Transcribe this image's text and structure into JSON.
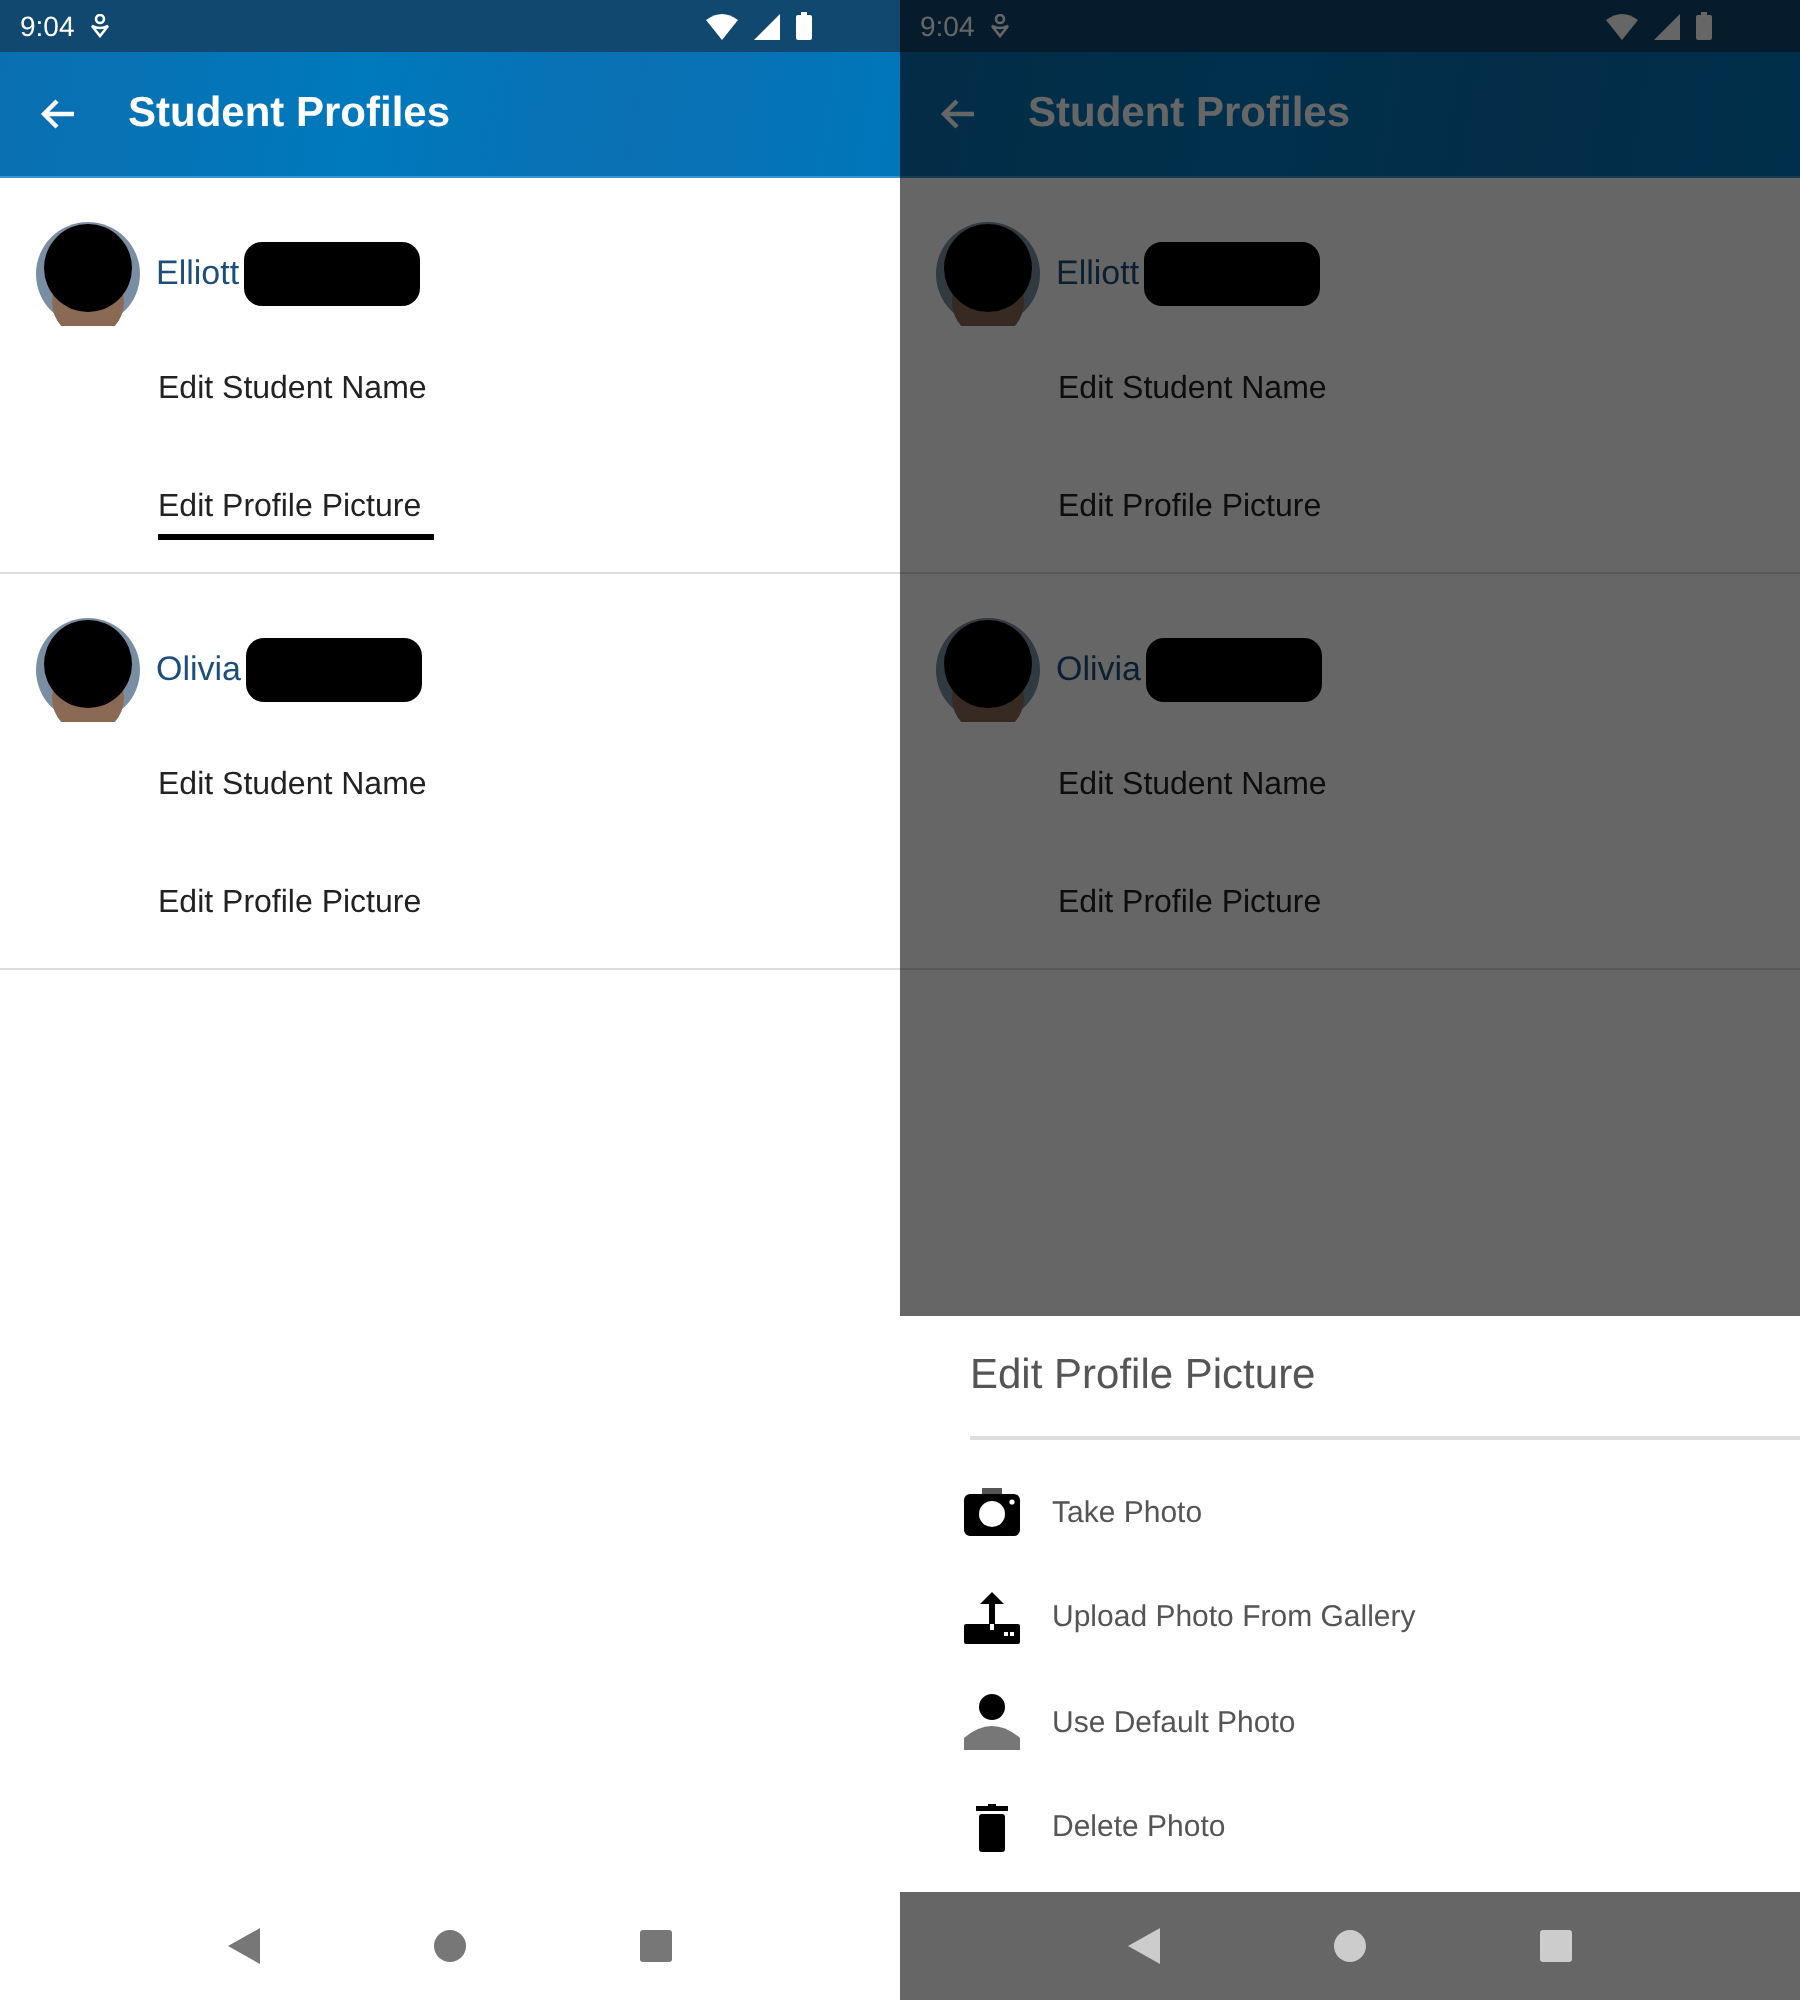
{
  "screens": [
    {
      "status_bar": {
        "time": "9:04"
      },
      "app_bar": {
        "title": "Student Profiles"
      },
      "dimmed": false,
      "students": [
        {
          "name": "Elliott",
          "actions": [
            {
              "label": "Edit Student Name",
              "underlined": false
            },
            {
              "label": "Edit Profile Picture",
              "underlined": true
            }
          ]
        },
        {
          "name": "Olivia",
          "actions": [
            {
              "label": "Edit Student Name",
              "underlined": false
            },
            {
              "label": "Edit Profile Picture",
              "underlined": false
            }
          ]
        }
      ]
    },
    {
      "status_bar": {
        "time": "9:04"
      },
      "app_bar": {
        "title": "Student Profiles"
      },
      "dimmed": true,
      "students": [
        {
          "name": "Elliott",
          "actions": [
            {
              "label": "Edit Student Name",
              "underlined": false
            },
            {
              "label": "Edit Profile Picture",
              "underlined": false
            }
          ]
        },
        {
          "name": "Olivia",
          "actions": [
            {
              "label": "Edit Student Name",
              "underlined": false
            },
            {
              "label": "Edit Profile Picture",
              "underlined": false
            }
          ]
        }
      ],
      "sheet": {
        "title": "Edit Profile Picture",
        "options": [
          {
            "kind": "camera",
            "label": "Take Photo"
          },
          {
            "kind": "upload",
            "label": "Upload Photo From Gallery"
          },
          {
            "kind": "person",
            "label": "Use Default Photo"
          },
          {
            "kind": "trash",
            "label": "Delete Photo"
          }
        ]
      }
    }
  ]
}
